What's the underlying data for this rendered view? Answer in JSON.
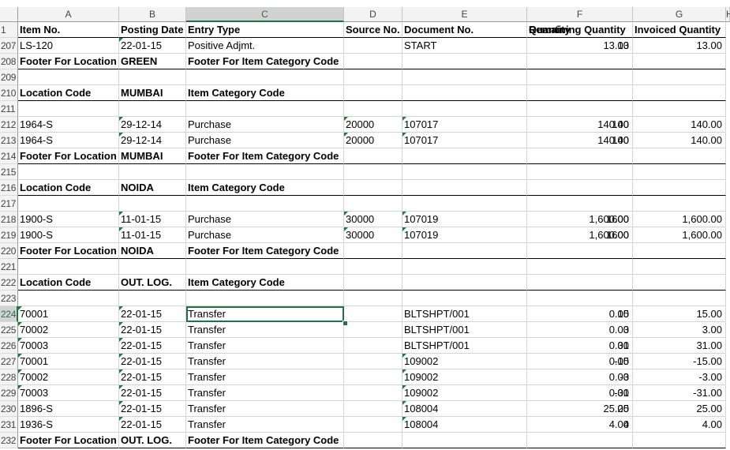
{
  "columns": [
    "A",
    "B",
    "C",
    "D",
    "E",
    "F",
    "G",
    "H"
  ],
  "rows": [
    {
      "num": "1",
      "cells": [
        "Item No.",
        "Posting Date",
        "Entry Type",
        "Source No.",
        "Document No.",
        "Quantity",
        "Remaining Quantity",
        "Invoiced Quantity"
      ]
    },
    {
      "num": "207",
      "cells": [
        "LS-120",
        "22-01-15",
        "Positive Adjmt.",
        "",
        "START",
        "13",
        "13.00",
        "13.00"
      ]
    },
    {
      "num": "208",
      "cells": [
        "Footer For Location",
        "GREEN",
        "Footer For Item Category Code",
        "",
        "",
        "",
        "",
        ""
      ]
    },
    {
      "num": "209",
      "cells": [
        "",
        "",
        "",
        "",
        "",
        "",
        "",
        ""
      ]
    },
    {
      "num": "210",
      "cells": [
        "Location Code",
        "MUMBAI",
        "Item Category Code",
        "",
        "",
        "",
        "",
        ""
      ]
    },
    {
      "num": "211",
      "cells": [
        "",
        "",
        "",
        "",
        "",
        "",
        "",
        ""
      ]
    },
    {
      "num": "212",
      "cells": [
        "1964-S",
        "29-12-14",
        "Purchase",
        "20000",
        "107017",
        "140",
        "140.00",
        "140.00"
      ]
    },
    {
      "num": "213",
      "cells": [
        "1964-S",
        "29-12-14",
        "Purchase",
        "20000",
        "107017",
        "140",
        "140.00",
        "140.00"
      ]
    },
    {
      "num": "214",
      "cells": [
        "Footer For Location",
        "MUMBAI",
        "Footer For Item Category Code",
        "",
        "",
        "",
        "",
        ""
      ]
    },
    {
      "num": "215",
      "cells": [
        "",
        "",
        "",
        "",
        "",
        "",
        "",
        ""
      ]
    },
    {
      "num": "216",
      "cells": [
        "Location Code",
        "NOIDA",
        "Item Category Code",
        "",
        "",
        "",
        "",
        ""
      ]
    },
    {
      "num": "217",
      "cells": [
        "",
        "",
        "",
        "",
        "",
        "",
        "",
        ""
      ]
    },
    {
      "num": "218",
      "cells": [
        "1900-S",
        "11-01-15",
        "Purchase",
        "30000",
        "107019",
        "1600",
        "1,600.00",
        "1,600.00"
      ]
    },
    {
      "num": "219",
      "cells": [
        "1900-S",
        "11-01-15",
        "Purchase",
        "30000",
        "107019",
        "1600",
        "1,600.00",
        "1,600.00"
      ]
    },
    {
      "num": "220",
      "cells": [
        "Footer For Location",
        "NOIDA",
        "Footer For Item Category Code",
        "",
        "",
        "",
        "",
        ""
      ]
    },
    {
      "num": "221",
      "cells": [
        "",
        "",
        "",
        "",
        "",
        "",
        "",
        ""
      ]
    },
    {
      "num": "222",
      "cells": [
        "Location Code",
        "OUT. LOG.",
        "Item Category Code",
        "",
        "",
        "",
        "",
        ""
      ]
    },
    {
      "num": "223",
      "cells": [
        "",
        "",
        "",
        "",
        "",
        "",
        "",
        ""
      ]
    },
    {
      "num": "224",
      "cells": [
        "70001",
        "22-01-15",
        "Transfer",
        "",
        "BLTSHPT/001",
        "15",
        "0.00",
        "15.00"
      ]
    },
    {
      "num": "225",
      "cells": [
        "70002",
        "22-01-15",
        "Transfer",
        "",
        "BLTSHPT/001",
        "3",
        "0.00",
        "3.00"
      ]
    },
    {
      "num": "226",
      "cells": [
        "70003",
        "22-01-15",
        "Transfer",
        "",
        "BLTSHPT/001",
        "31",
        "0.00",
        "31.00"
      ]
    },
    {
      "num": "227",
      "cells": [
        "70001",
        "22-01-15",
        "Transfer",
        "",
        "109002",
        "-15",
        "0.00",
        "-15.00"
      ]
    },
    {
      "num": "228",
      "cells": [
        "70002",
        "22-01-15",
        "Transfer",
        "",
        "109002",
        "-3",
        "0.00",
        "-3.00"
      ]
    },
    {
      "num": "229",
      "cells": [
        "70003",
        "22-01-15",
        "Transfer",
        "",
        "109002",
        "-31",
        "0.00",
        "-31.00"
      ]
    },
    {
      "num": "230",
      "cells": [
        "1896-S",
        "22-01-15",
        "Transfer",
        "",
        "108004",
        "25",
        "25.00",
        "25.00"
      ]
    },
    {
      "num": "231",
      "cells": [
        "1936-S",
        "22-01-15",
        "Transfer",
        "",
        "108004",
        "4",
        "4.00",
        "4.00"
      ]
    },
    {
      "num": "232",
      "cells": [
        "Footer For Location",
        "OUT. LOG.",
        "Footer For Item Category Code",
        "",
        "",
        "",
        "",
        ""
      ]
    }
  ],
  "selection": {
    "column": "C",
    "row": "224"
  },
  "colors": {
    "accent": "#217346",
    "error_triangle": "#1e7a3c"
  }
}
